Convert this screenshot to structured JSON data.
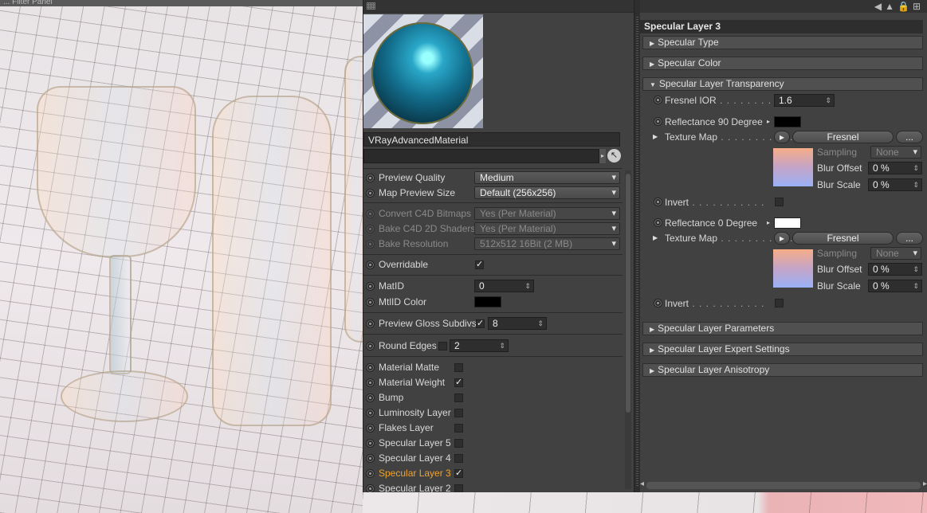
{
  "viewport": {
    "menu_text": "... Filter  Panel"
  },
  "material": {
    "name": "VRayAdvancedMaterial",
    "search_value": ""
  },
  "params": [
    {
      "label": "Preview Quality",
      "value": "Medium",
      "type": "select"
    },
    {
      "label": "Map Preview Size",
      "value": "Default (256x256)",
      "type": "select"
    },
    {
      "label": "Convert C4D Bitmaps",
      "value": "Yes (Per Material)",
      "type": "select",
      "disabled": true
    },
    {
      "label": "Bake C4D 2D Shaders",
      "value": "Yes (Per Material)",
      "type": "select",
      "disabled": true
    },
    {
      "label": "Bake Resolution",
      "value": "512x512   16Bit   (2 MB)",
      "type": "select",
      "disabled": true
    },
    {
      "label": "Overridable",
      "checked": true,
      "type": "check"
    },
    {
      "label": "MatID",
      "value": "0",
      "type": "number"
    },
    {
      "label": "MtlID Color",
      "color": "#000000",
      "type": "color"
    },
    {
      "label": "Preview Gloss Subdivs",
      "checked": true,
      "value": "8",
      "type": "checknum"
    },
    {
      "label": "Round Edges",
      "checked": false,
      "value": "2",
      "type": "checknum"
    }
  ],
  "layers": [
    {
      "label": "Material Matte",
      "checked": false
    },
    {
      "label": "Material Weight",
      "checked": true
    },
    {
      "label": "Bump",
      "checked": false
    },
    {
      "label": "Luminosity Layer",
      "checked": false
    },
    {
      "label": "Flakes Layer",
      "checked": false
    },
    {
      "label": "Specular Layer 5",
      "checked": false
    },
    {
      "label": "Specular Layer 4",
      "checked": false
    },
    {
      "label": "Specular Layer 3",
      "checked": true,
      "active": true
    },
    {
      "label": "Specular Layer 2",
      "checked": false
    }
  ],
  "right": {
    "title": "Specular Layer 3",
    "groups": {
      "type": "Specular Type",
      "color": "Specular Color",
      "transparency": "Specular Layer Transparency",
      "params": "Specular Layer Parameters",
      "expert": "Specular Layer Expert Settings",
      "aniso": "Specular Layer Anisotropy"
    },
    "fresnel_ior": {
      "label": "Fresnel IOR",
      "value": "1.6"
    },
    "refl90": {
      "label": "Reflectance 90 Degree",
      "color": "#000000"
    },
    "refl0": {
      "label": "Reflectance   0 Degree",
      "color": "#ffffff"
    },
    "texture_map_label": "Texture Map",
    "shader_name": "Fresnel",
    "more_button": "...",
    "sampling_label": "Sampling",
    "sampling_value": "None",
    "blur_offset_label": "Blur Offset",
    "blur_offset_value": "0 %",
    "blur_scale_label": "Blur Scale",
    "blur_scale_value": "0 %",
    "invert_label": "Invert"
  }
}
